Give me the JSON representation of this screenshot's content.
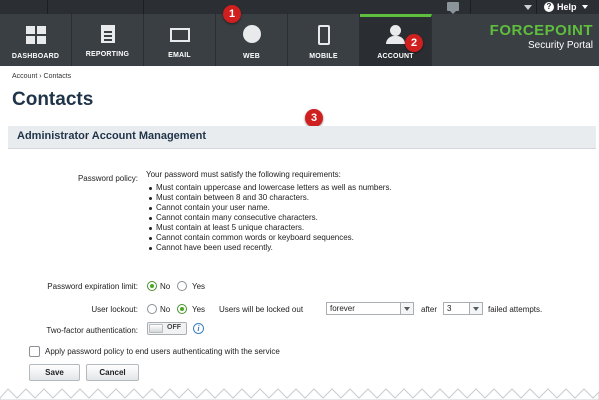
{
  "utility": {
    "mail_icon": "mail-icon",
    "help_label": "Help"
  },
  "nav": {
    "items": [
      {
        "label": "DASHBOARD",
        "icon": "dashboard-icon"
      },
      {
        "label": "REPORTING",
        "icon": "report-icon"
      },
      {
        "label": "EMAIL",
        "icon": "email-icon"
      },
      {
        "label": "WEB",
        "icon": "globe-icon"
      },
      {
        "label": "MOBILE",
        "icon": "mobile-icon"
      },
      {
        "label": "ACCOUNT",
        "icon": "user-icon",
        "active": true
      }
    ],
    "brand_name": "FORCEPOINT",
    "brand_sub": "Security Portal"
  },
  "callouts": [
    "1",
    "2",
    "3"
  ],
  "breadcrumb": "Account › Contacts",
  "page_title": "Contacts",
  "section_title": "Administrator Account Management",
  "password_policy": {
    "label": "Password policy:",
    "intro": "Your password must satisfy the following requirements:",
    "rules": [
      "Must contain uppercase and lowercase letters as well as numbers.",
      "Must contain between 8 and 30 characters.",
      "Cannot contain your user name.",
      "Cannot contain many consecutive characters.",
      "Must contain at least 5 unique characters.",
      "Cannot contain common words or keyboard sequences.",
      "Cannot have been used recently."
    ]
  },
  "expiration": {
    "label": "Password expiration limit:",
    "no": "No",
    "yes": "Yes",
    "selected": "No"
  },
  "lockout": {
    "label": "User lockout:",
    "no": "No",
    "yes": "Yes",
    "selected": "Yes",
    "text1": "Users will be locked out",
    "duration": "forever",
    "text2": "after",
    "attempts": "3",
    "text3": "failed attempts."
  },
  "two_factor": {
    "label": "Two-factor authentication:",
    "state": "OFF"
  },
  "apply_policy": {
    "label": "Apply password policy to end users authenticating with the service",
    "checked": false
  },
  "buttons": {
    "save": "Save",
    "cancel": "Cancel"
  },
  "colors": {
    "accent": "#5fbe3d",
    "nav_bg": "#3a3f44",
    "title": "#1f3448",
    "callout": "#d01f1f"
  }
}
